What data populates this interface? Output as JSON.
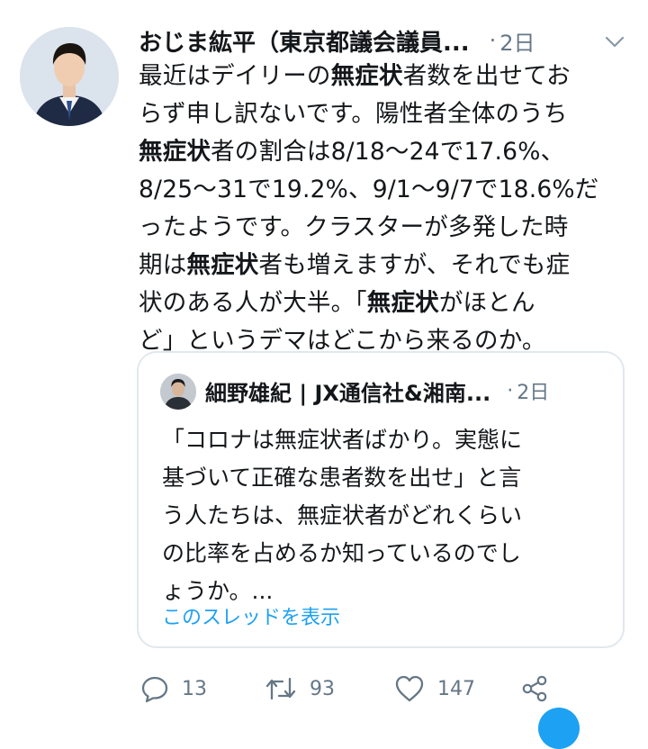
{
  "tweet": {
    "author_name": "おじま紘平（東京都議会議員...",
    "dot": "·",
    "time": "2日",
    "body_lines": [
      [
        {
          "t": "最近はデイリーの"
        },
        {
          "t": "無症状",
          "b": true
        },
        {
          "t": "者数を出せてお"
        }
      ],
      [
        {
          "t": "らず申し訳ないです。陽性者全体のうち"
        }
      ],
      [
        {
          "t": "無症状",
          "b": true
        },
        {
          "t": "者の割合は8/18〜24で17.6%、"
        }
      ],
      [
        {
          "t": "8/25〜31で19.2%、9/1〜9/7で18.6%だ"
        }
      ],
      [
        {
          "t": "ったようです。クラスターが多発した時"
        }
      ],
      [
        {
          "t": "期は"
        },
        {
          "t": "無症状",
          "b": true
        },
        {
          "t": "者も増えますが、それでも症"
        }
      ],
      [
        {
          "t": "状のある人が大半。「"
        },
        {
          "t": "無症状",
          "b": true
        },
        {
          "t": "がほとん"
        }
      ],
      [
        {
          "t": "ど」というデマはどこから来るのか。"
        }
      ]
    ]
  },
  "quoted_tweet": {
    "author_name": "細野雄紀 | JX通信社&湘南...",
    "dot": "·",
    "time": "2日",
    "text_lines": [
      "「コロナは無症状者ばかり。実態に",
      "基づいて正確な患者数を出せ」と言",
      "う人たちは、無症状者がどれくらい",
      "の比率を占めるか知っているのでし",
      "ょうか。..."
    ],
    "thread_link": "このスレッドを表示"
  },
  "actions": {
    "reply_count": "13",
    "retweet_count": "93",
    "like_count": "147"
  },
  "icons": {
    "reply": "comment-icon",
    "retweet": "retweet-icon",
    "like": "heart-icon",
    "share": "share-icon",
    "menu": "chevron-down-icon"
  },
  "colors": {
    "accent": "#1da1f2",
    "text": "#14171a",
    "secondary": "#657786",
    "border": "#e1e8ed"
  }
}
